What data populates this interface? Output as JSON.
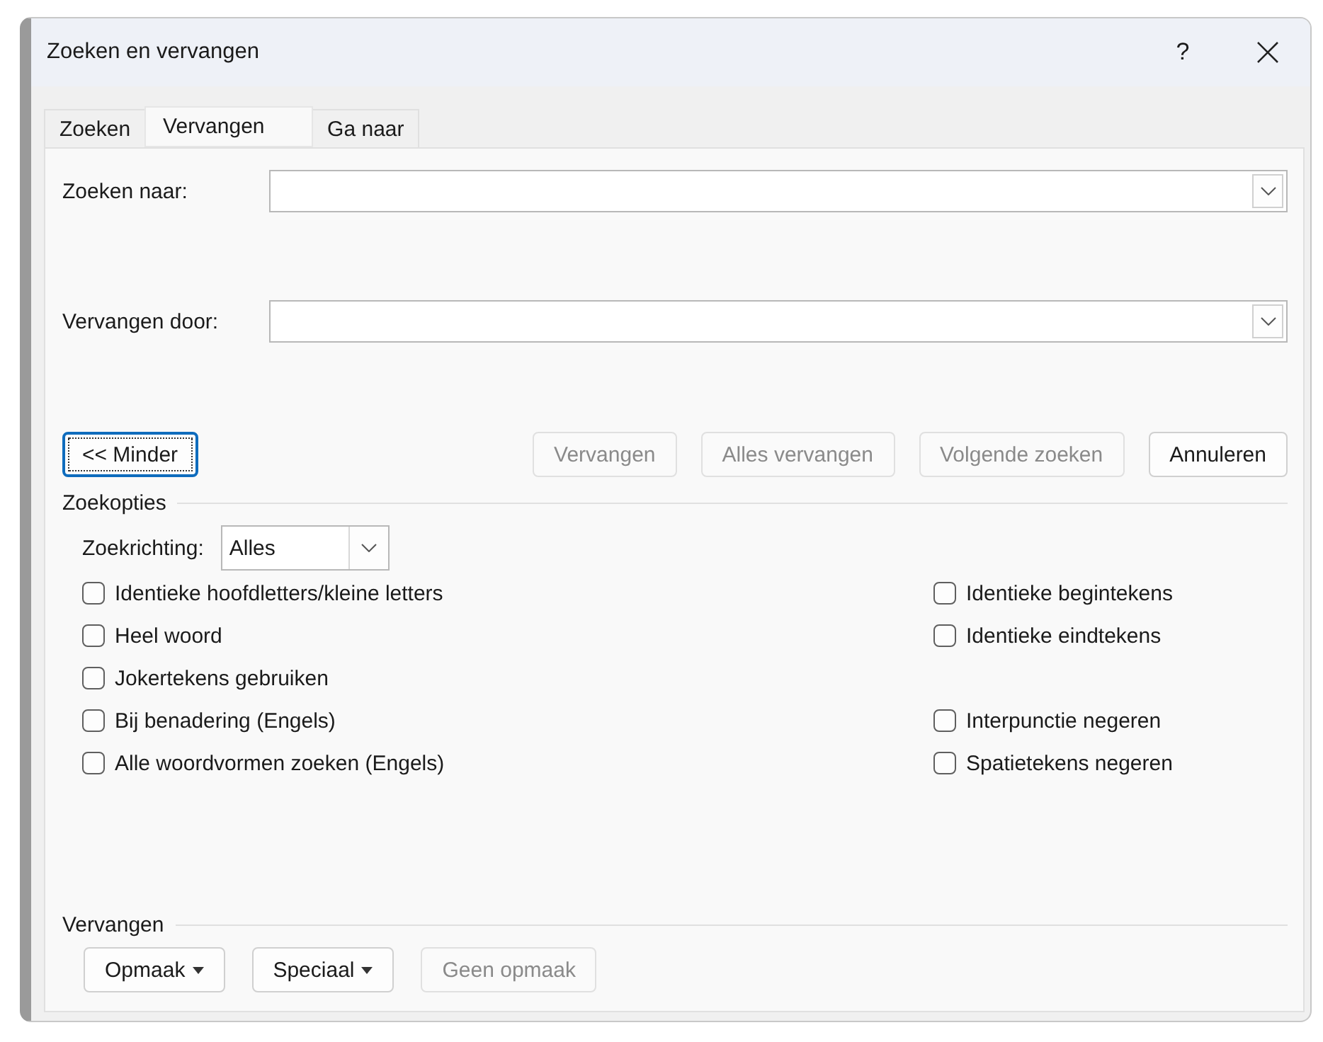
{
  "window": {
    "title": "Zoeken en vervangen",
    "help": "?"
  },
  "tabs": [
    {
      "label": "Zoeken",
      "selected": false
    },
    {
      "label": "Vervangen",
      "selected": true
    },
    {
      "label": "Ga naar",
      "selected": false
    }
  ],
  "fields": [
    {
      "label": "Zoeken naar:"
    },
    {
      "label": "Vervangen door:"
    }
  ],
  "action_buttons": [
    {
      "label": "<< Minder",
      "disabled": false,
      "focused": true
    },
    {
      "label": "Vervangen",
      "disabled": true,
      "focused": false
    },
    {
      "label": "Alles vervangen",
      "disabled": true,
      "focused": false
    },
    {
      "label": "Volgende zoeken",
      "disabled": true,
      "focused": false
    },
    {
      "label": "Annuleren",
      "disabled": false,
      "focused": false
    }
  ],
  "search_options": {
    "heading": "Zoekopties",
    "direction_label": "Zoekrichting:",
    "direction_value": "Alles",
    "rows": [
      {
        "left": {
          "label": "Identieke hoofdletters/kleine letters",
          "checked": false
        },
        "right": {
          "label": "Identieke begintekens",
          "checked": false
        }
      },
      {
        "left": {
          "label": "Heel woord",
          "checked": false
        },
        "right": {
          "label": "Identieke eindtekens",
          "checked": false
        }
      },
      {
        "left": {
          "label": "Jokertekens gebruiken",
          "checked": false
        }
      },
      {
        "left": {
          "label": "Bij benadering (Engels)",
          "checked": false
        },
        "right": {
          "label": "Interpunctie negeren",
          "checked": false
        }
      },
      {
        "left": {
          "label": "Alle woordvormen zoeken (Engels)",
          "checked": false
        },
        "right": {
          "label": "Spatietekens negeren",
          "checked": false
        }
      }
    ]
  },
  "replace_section": {
    "heading": "Vervangen",
    "buttons": [
      {
        "label": "Opmaak",
        "dropdown": true,
        "disabled": false
      },
      {
        "label": "Speciaal",
        "dropdown": true,
        "disabled": false
      },
      {
        "label": "Geen opmaak",
        "dropdown": false,
        "disabled": true
      }
    ]
  }
}
